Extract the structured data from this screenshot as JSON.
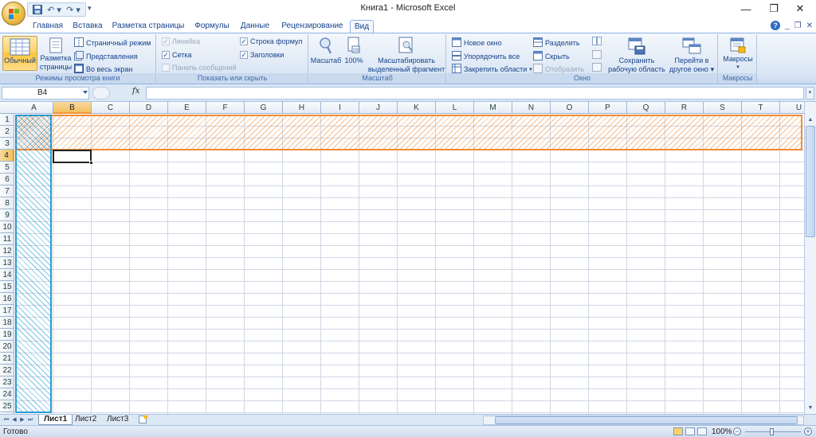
{
  "window": {
    "title": "Книга1 - Microsoft Excel",
    "minimize": "—",
    "restore": "❐",
    "close": "✕"
  },
  "qat": {
    "save": "💾",
    "undo": "↶ ▾",
    "redo": "↷ ▾",
    "more": "▾"
  },
  "tabs": [
    "Главная",
    "Вставка",
    "Разметка страницы",
    "Формулы",
    "Данные",
    "Рецензирование",
    "Вид"
  ],
  "active_tab": "Вид",
  "help": {
    "help": "?",
    "min": "_",
    "restore": "❐",
    "close": "✕"
  },
  "ribbon": {
    "views_group": {
      "label": "Режимы просмотра книги",
      "normal": "Обычный",
      "page_layout_line1": "Разметка",
      "page_layout_line2": "страницы",
      "page_break": "Страничный режим",
      "custom_views": "Представления",
      "full_screen": "Во весь экран"
    },
    "show_group": {
      "label": "Показать или скрыть",
      "ruler": "Линейка",
      "gridlines": "Сетка",
      "message_bar": "Панель сообщений",
      "formula_bar": "Строка формул",
      "headings": "Заголовки",
      "ruler_checked": true,
      "gridlines_checked": true,
      "message_bar_checked": false,
      "formula_bar_checked": true,
      "headings_checked": true
    },
    "zoom_group": {
      "label": "Масштаб",
      "zoom": "Масштаб",
      "zoom_100": "100%",
      "zoom_sel_line1": "Масштабировать",
      "zoom_sel_line2": "выделенный фрагмент"
    },
    "window_group": {
      "label": "Окно",
      "new_window": "Новое окно",
      "arrange_all": "Упорядочить все",
      "freeze_panes": "Закрепить области",
      "split": "Разделить",
      "hide": "Скрыть",
      "unhide": "Отобразить",
      "save_ws_line1": "Сохранить",
      "save_ws_line2": "рабочую область",
      "switch_line1": "Перейти в",
      "switch_line2": "другое окно"
    },
    "macros_group": {
      "label": "Макросы",
      "macros": "Макросы"
    }
  },
  "formula_bar": {
    "name_box": "B4",
    "fx": "fx",
    "value": ""
  },
  "columns": [
    "A",
    "B",
    "C",
    "D",
    "E",
    "F",
    "G",
    "H",
    "I",
    "J",
    "K",
    "L",
    "M",
    "N",
    "O",
    "P",
    "Q",
    "R",
    "S",
    "T",
    "U"
  ],
  "rows": [
    "1",
    "2",
    "3",
    "4",
    "5",
    "6",
    "7",
    "8",
    "9",
    "10",
    "11",
    "12",
    "13",
    "14",
    "15",
    "16",
    "17",
    "18",
    "19",
    "20",
    "21",
    "22",
    "23",
    "24",
    "25"
  ],
  "active_cell": "B4",
  "sheets": [
    "Лист1",
    "Лист2",
    "Лист3"
  ],
  "active_sheet": "Лист1",
  "status": {
    "text": "Готово",
    "zoom": "100%"
  },
  "colors": {
    "freeze_rows": "#f28b35",
    "freeze_col": "#2a9bd4",
    "selection": "#f1c15f"
  }
}
